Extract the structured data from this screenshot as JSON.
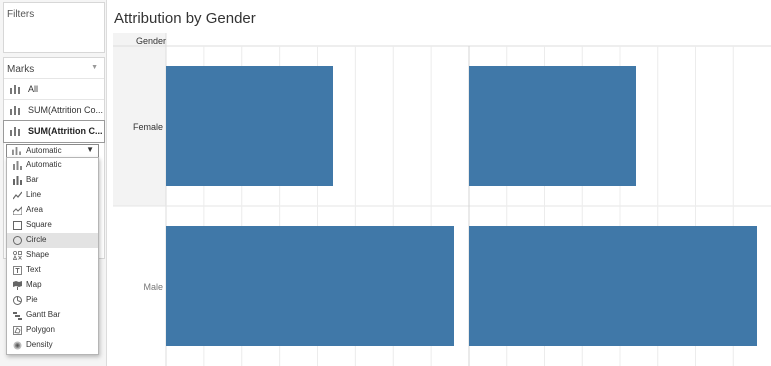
{
  "filters": {
    "title": "Filters"
  },
  "marks": {
    "title": "Marks",
    "rows": [
      {
        "label": "All"
      },
      {
        "label": "SUM(Attrition Co..."
      },
      {
        "label": "SUM(Attrition C..."
      }
    ],
    "mark_type": {
      "selected": "Automatic"
    },
    "menu_items": [
      {
        "label": "Automatic",
        "icon": "automatic-bar-icon"
      },
      {
        "label": "Bar",
        "icon": "bar-icon"
      },
      {
        "label": "Line",
        "icon": "line-icon"
      },
      {
        "label": "Area",
        "icon": "area-icon"
      },
      {
        "label": "Square",
        "icon": "square-icon"
      },
      {
        "label": "Circle",
        "icon": "circle-icon"
      },
      {
        "label": "Shape",
        "icon": "shape-icon"
      },
      {
        "label": "Text",
        "icon": "text-icon"
      },
      {
        "label": "Map",
        "icon": "map-icon"
      },
      {
        "label": "Pie",
        "icon": "pie-icon"
      },
      {
        "label": "Gantt Bar",
        "icon": "gantt-bar-icon"
      },
      {
        "label": "Polygon",
        "icon": "polygon-icon"
      },
      {
        "label": "Density",
        "icon": "density-icon"
      }
    ],
    "highlighted_item": "Circle"
  },
  "view": {
    "title": "Attribution by Gender",
    "row_shelf_label": "Gender"
  },
  "chart_data": {
    "type": "bar",
    "title": "Attribution by Gender",
    "categories": [
      "Female",
      "Male"
    ],
    "series": [
      {
        "values": [
          0.58,
          1.0
        ]
      },
      {
        "values": [
          0.58,
          1.0
        ]
      }
    ],
    "bar_color": "#4078a8",
    "grid": true
  }
}
